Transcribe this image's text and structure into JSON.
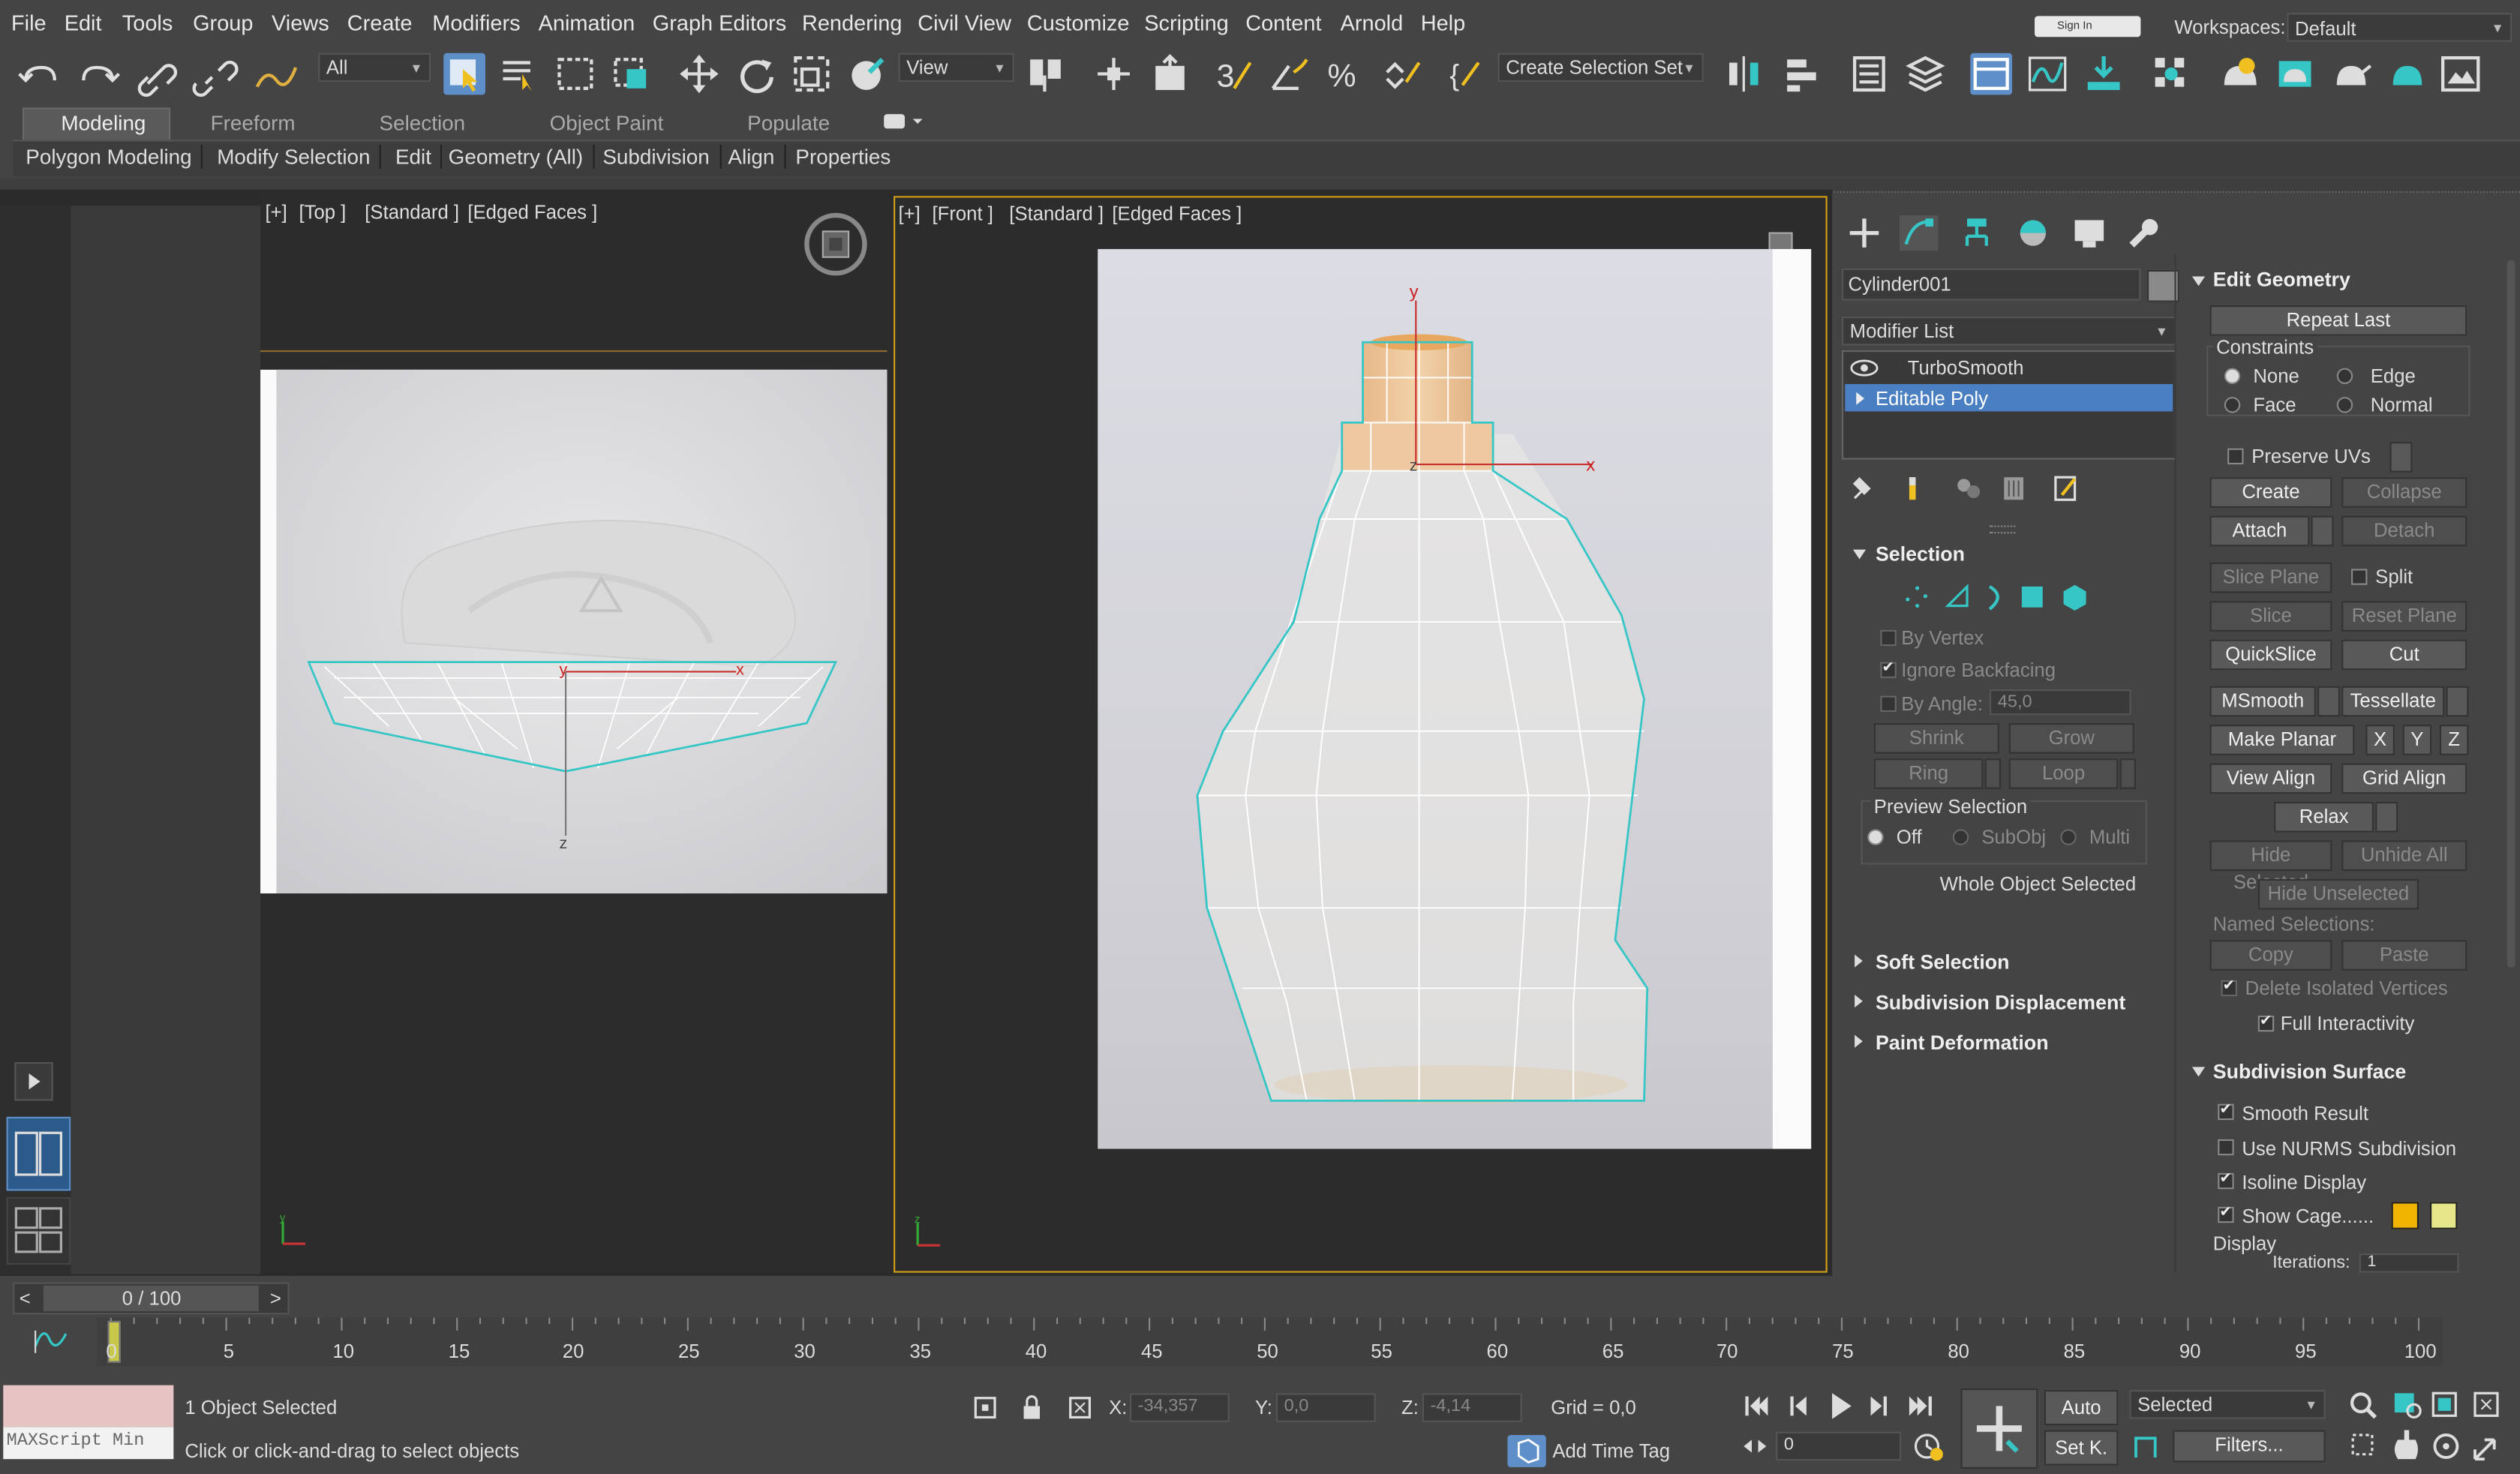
{
  "menu": [
    "File",
    "Edit",
    "Tools",
    "Group",
    "Views",
    "Create",
    "Modifiers",
    "Animation",
    "Graph Editors",
    "Rendering",
    "Civil View",
    "Customize",
    "Scripting",
    "Content",
    "Arnold",
    "Help"
  ],
  "signin": {
    "label": "Sign In"
  },
  "workspaces": {
    "label": "Workspaces:",
    "value": "Default"
  },
  "toolbar": {
    "filter": "All",
    "refcoord": "View",
    "selection_set": "Create Selection Set"
  },
  "ribbon": {
    "tabs": [
      "Modeling",
      "Freeform",
      "Selection",
      "Object Paint",
      "Populate"
    ],
    "buttons": [
      "Polygon Modeling",
      "Modify Selection",
      "Edit",
      "Geometry (All)",
      "Subdivision",
      "Align",
      "Properties"
    ]
  },
  "viewports": {
    "top": {
      "plus": "[+]",
      "view": "[Top ]",
      "shade": "[Standard ]",
      "mode": "[Edged Faces ]"
    },
    "front": {
      "plus": "[+]",
      "view": "[Front ]",
      "shade": "[Standard ]",
      "mode": "[Edged Faces ]"
    },
    "axis": {
      "x": "x",
      "y": "y",
      "z": "z"
    }
  },
  "command_panel": {
    "object_name": "Cylinder001",
    "modifier_list": "Modifier List",
    "stack": [
      "TurboSmooth",
      "Editable Poly"
    ],
    "selection": {
      "title": "Selection",
      "by_vertex": "By Vertex",
      "ignore_backfacing": "Ignore Backfacing",
      "by_angle": "By Angle:",
      "angle_value": "45,0",
      "shrink": "Shrink",
      "grow": "Grow",
      "ring": "Ring",
      "loop": "Loop",
      "preview_selection": "Preview Selection",
      "preview_opts": [
        "Off",
        "SubObj",
        "Multi"
      ],
      "status": "Whole Object Selected"
    },
    "rollouts": [
      "Soft Selection",
      "Subdivision Displacement",
      "Paint Deformation"
    ],
    "edit_geometry": {
      "title": "Edit Geometry",
      "repeat_last": "Repeat Last",
      "constraints": "Constraints",
      "constraint_opts": [
        "None",
        "Edge",
        "Face",
        "Normal"
      ],
      "preserve_uvs": "Preserve UVs",
      "create": "Create",
      "collapse": "Collapse",
      "attach": "Attach",
      "detach": "Detach",
      "slice_plane": "Slice Plane",
      "split": "Split",
      "slice": "Slice",
      "reset_plane": "Reset Plane",
      "quickslice": "QuickSlice",
      "cut": "Cut",
      "msmooth": "MSmooth",
      "tessellate": "Tessellate",
      "make_planar": "Make Planar",
      "x": "X",
      "y": "Y",
      "z": "Z",
      "view_align": "View Align",
      "grid_align": "Grid Align",
      "relax": "Relax",
      "hide_selected": "Hide Selected",
      "unhide_all": "Unhide All",
      "hide_unselected": "Hide Unselected",
      "named_selections": "Named Selections:",
      "copy": "Copy",
      "paste": "Paste",
      "delete_isolated": "Delete Isolated Vertices",
      "full_interactivity": "Full Interactivity"
    },
    "subdivision_surface": {
      "title": "Subdivision Surface",
      "smooth_result": "Smooth Result",
      "use_nurms": "Use NURMS Subdivision",
      "isoline": "Isoline Display",
      "show_cage": "Show Cage......",
      "display": "Display",
      "iterations": "Iterations:",
      "iterations_value": "1",
      "cage_colors": [
        "#f0b400",
        "#e6e68a"
      ]
    }
  },
  "timeline": {
    "frame": "0 / 100",
    "ticks": [
      "0",
      "5",
      "10",
      "15",
      "20",
      "25",
      "30",
      "35",
      "40",
      "45",
      "50",
      "55",
      "60",
      "65",
      "70",
      "75",
      "80",
      "85",
      "90",
      "95",
      "100"
    ]
  },
  "status": {
    "maxscript": "MAXScript Min",
    "selected": "1 Object Selected",
    "prompt": "Click or click-and-drag to select objects",
    "x_label": "X:",
    "x": "-34,357",
    "y_label": "Y:",
    "y": "0,0",
    "z_label": "Z:",
    "z": "-4,14",
    "grid": "Grid = 0,0",
    "add_time_tag": "Add Time Tag",
    "auto": "Auto",
    "setk": "Set K.",
    "selected_dd": "Selected",
    "filters": "Filters...",
    "frame_field": "0"
  },
  "colors": {
    "accent": "#5f8fc8",
    "active_border": "#d4a017",
    "cyan": "#36c6c6"
  }
}
